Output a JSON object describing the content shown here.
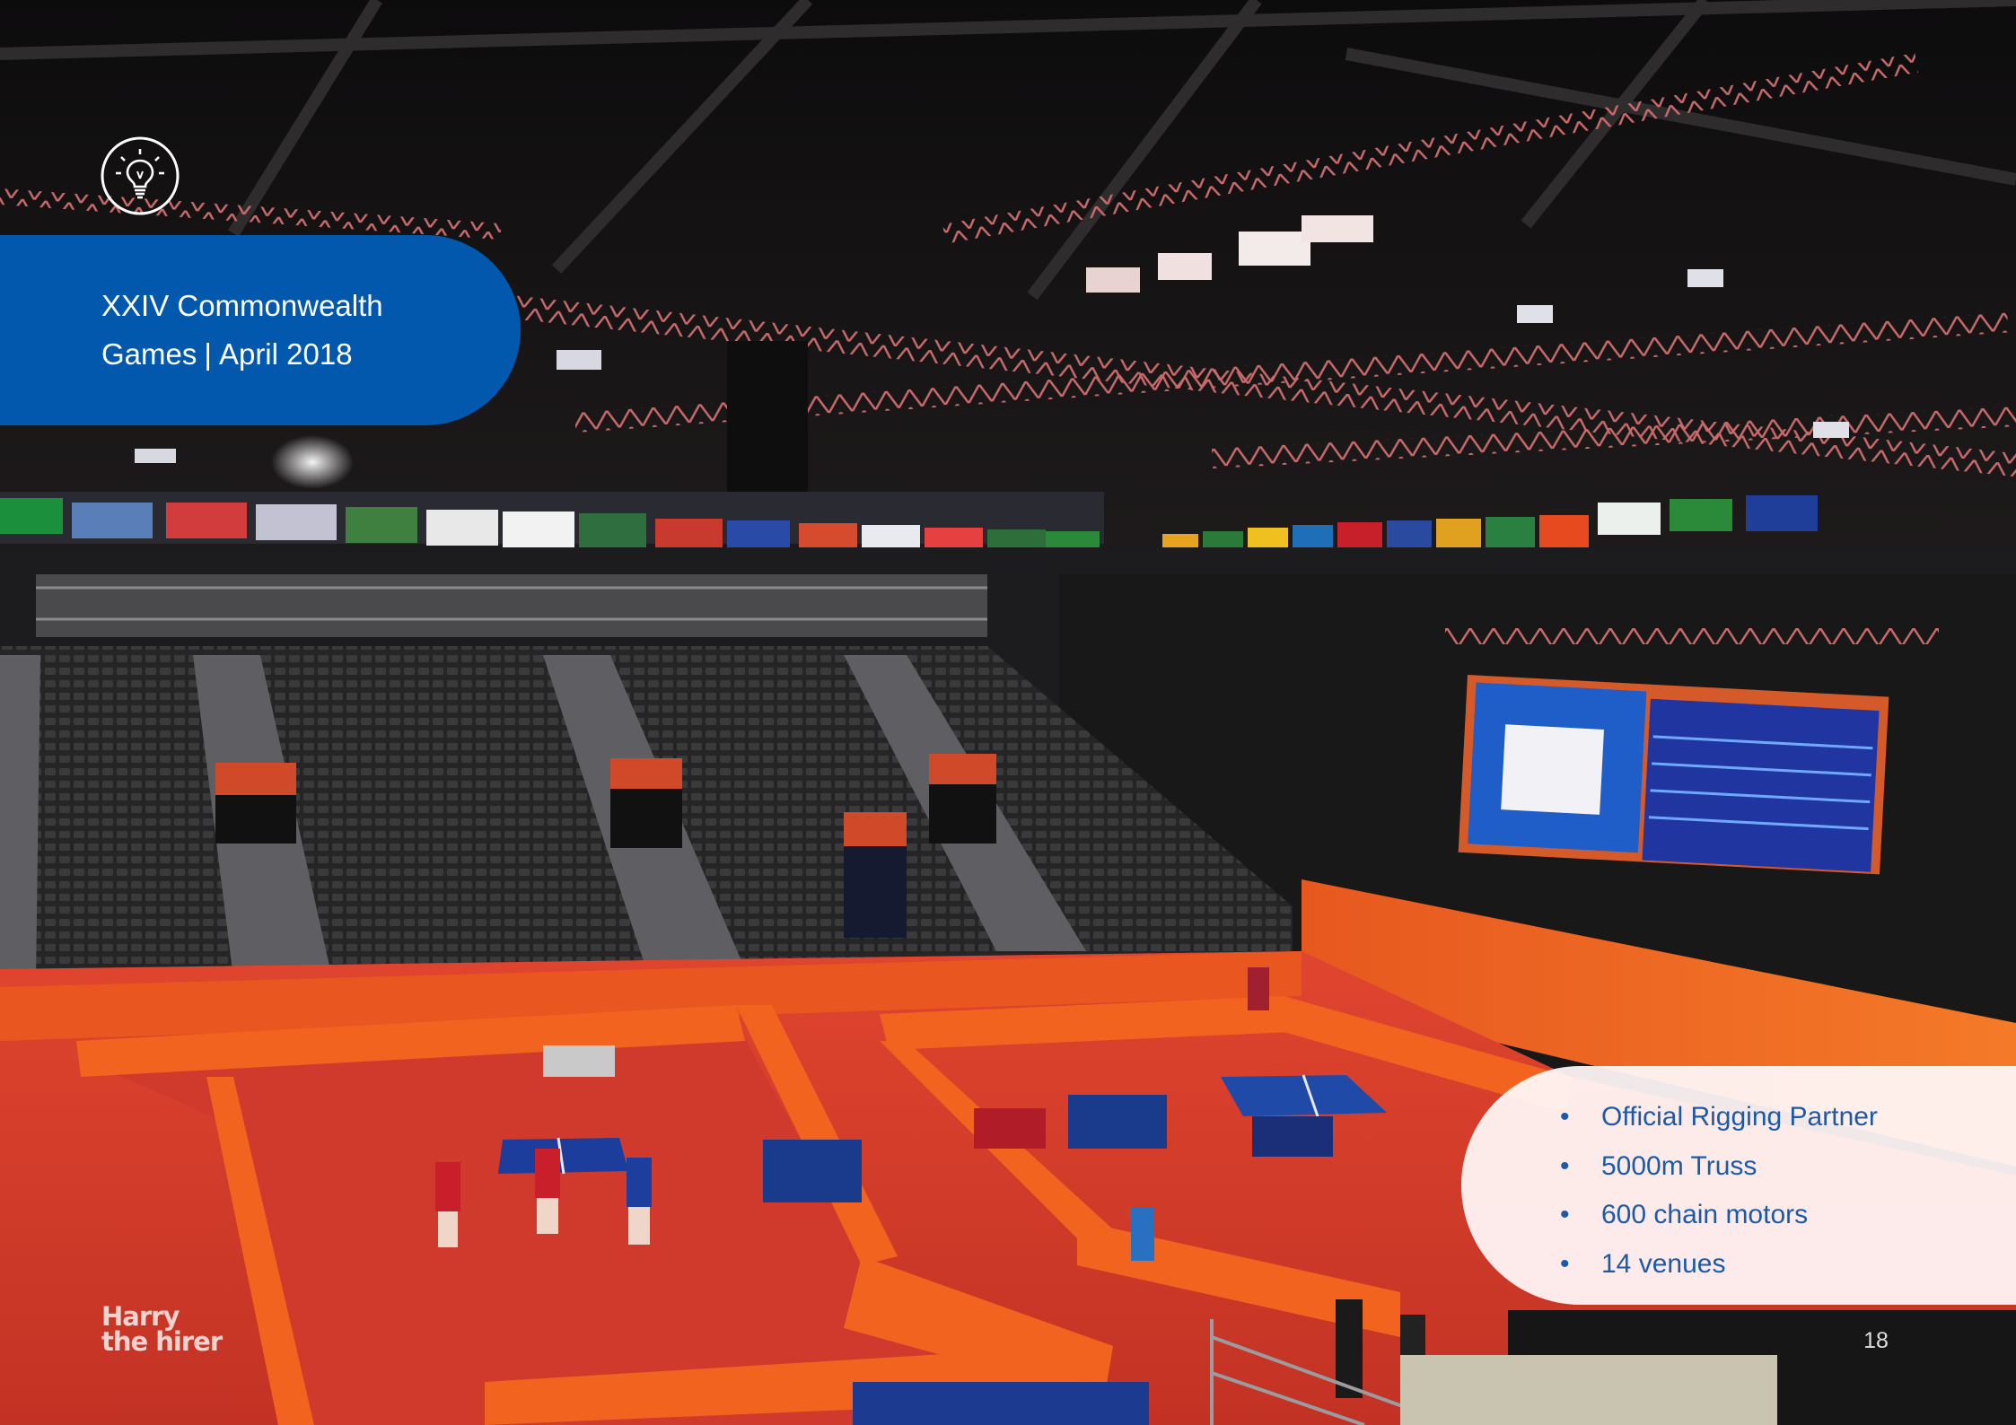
{
  "title": {
    "line1": "XXIV Commonwealth",
    "line2_a": "Games",
    "separator": "|",
    "line2_b": "April 2018"
  },
  "facts": [
    "Official Rigging Partner",
    "5000m Truss",
    "600 chain motors",
    "14 venues"
  ],
  "page_number": "18",
  "logo": {
    "line1": "Harry",
    "line2": "the hirer"
  },
  "icon": "lightbulb-icon",
  "colors": {
    "title_panel": "#0158ad",
    "fact_text": "#1d5aa6",
    "court_floor": "#d8392b",
    "banner_orange": "#ec5a1e"
  }
}
